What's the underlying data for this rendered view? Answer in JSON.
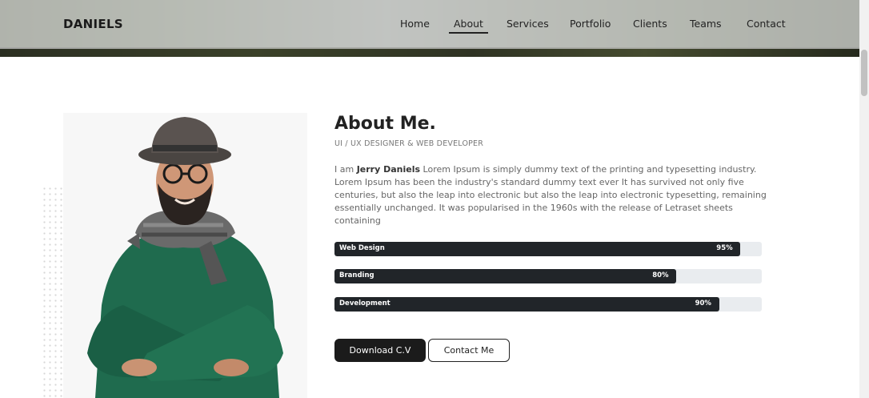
{
  "header": {
    "logo": "DANIELS",
    "nav": [
      {
        "label": "Home",
        "active": false
      },
      {
        "label": "About",
        "active": true
      },
      {
        "label": "Services",
        "active": false
      },
      {
        "label": "Portfolio",
        "active": false
      },
      {
        "label": "Clients",
        "active": false
      },
      {
        "label": "Teams",
        "active": false
      },
      {
        "label": "Contact",
        "active": false
      }
    ]
  },
  "about": {
    "title": "About Me.",
    "subtitle": "UI / UX DESIGNER & WEB DEVELOPER",
    "intro_prefix": "I am ",
    "name": "Jerry Daniels",
    "intro_rest": " Lorem Ipsum is simply dummy text of the printing and typesetting industry. Lorem Ipsum has been the industry's standard dummy text ever It has survived not only five centuries, but also the leap into electronic but also the leap into electronic typesetting, remaining essentially unchanged. It was popularised in the 1960s with the release of Letraset sheets containing"
  },
  "skills": [
    {
      "name": "Web Design",
      "percent_label": "95%",
      "value": 95
    },
    {
      "name": "Branding",
      "percent_label": "80%",
      "value": 80
    },
    {
      "name": "Development",
      "percent_label": "90%",
      "value": 90
    }
  ],
  "buttons": {
    "download": "Download C.V",
    "contact": "Contact Me"
  },
  "colors": {
    "accent_dark": "#212529",
    "bar_track": "#e9ecef",
    "sweater_green": "#1f6b4e"
  }
}
